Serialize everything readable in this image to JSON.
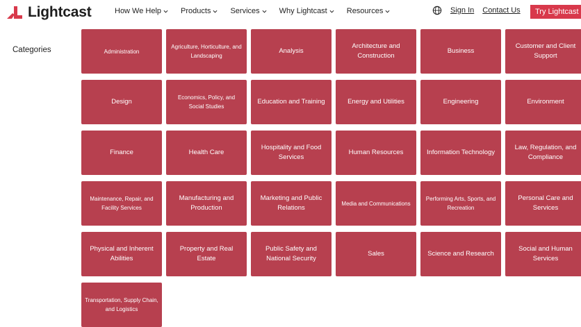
{
  "header": {
    "logo_text": "Lightcast",
    "nav": [
      {
        "label": "How We Help"
      },
      {
        "label": "Products"
      },
      {
        "label": "Services"
      },
      {
        "label": "Why Lightcast"
      },
      {
        "label": "Resources"
      }
    ],
    "sign_in": "Sign In",
    "contact_us": "Contact Us",
    "cta": "Try Lightcast"
  },
  "sidebar": {
    "categories_label": "Categories"
  },
  "colors": {
    "brand": "#d8394b",
    "tile": "#b7404f"
  },
  "tiles": [
    {
      "label": "Administration",
      "small": true
    },
    {
      "label": "Agriculture, Horticulture, and Landscaping",
      "small": true
    },
    {
      "label": "Analysis",
      "small": false
    },
    {
      "label": "Architecture and Construction",
      "small": false
    },
    {
      "label": "Business",
      "small": false
    },
    {
      "label": "Customer and Client Support",
      "small": false
    },
    {
      "label": "Design",
      "small": false
    },
    {
      "label": "Economics, Policy, and Social Studies",
      "small": true
    },
    {
      "label": "Education and Training",
      "small": false
    },
    {
      "label": "Energy and Utilities",
      "small": false
    },
    {
      "label": "Engineering",
      "small": false
    },
    {
      "label": "Environment",
      "small": false
    },
    {
      "label": "Finance",
      "small": false
    },
    {
      "label": "Health Care",
      "small": false
    },
    {
      "label": "Hospitality and Food Services",
      "small": false
    },
    {
      "label": "Human Resources",
      "small": false
    },
    {
      "label": "Information Technology",
      "small": false
    },
    {
      "label": "Law, Regulation, and Compliance",
      "small": false
    },
    {
      "label": "Maintenance, Repair, and Facility Services",
      "small": true
    },
    {
      "label": "Manufacturing and Production",
      "small": false
    },
    {
      "label": "Marketing and Public Relations",
      "small": false
    },
    {
      "label": "Media and Communications",
      "small": true
    },
    {
      "label": "Performing Arts, Sports, and Recreation",
      "small": true
    },
    {
      "label": "Personal Care and Services",
      "small": false
    },
    {
      "label": "Physical and Inherent Abilities",
      "small": false
    },
    {
      "label": "Property and Real Estate",
      "small": false
    },
    {
      "label": "Public Safety and National Security",
      "small": false
    },
    {
      "label": "Sales",
      "small": false
    },
    {
      "label": "Science and Research",
      "small": false
    },
    {
      "label": "Social and Human Services",
      "small": false
    },
    {
      "label": "Transportation, Supply Chain, and Logistics",
      "small": true
    }
  ]
}
